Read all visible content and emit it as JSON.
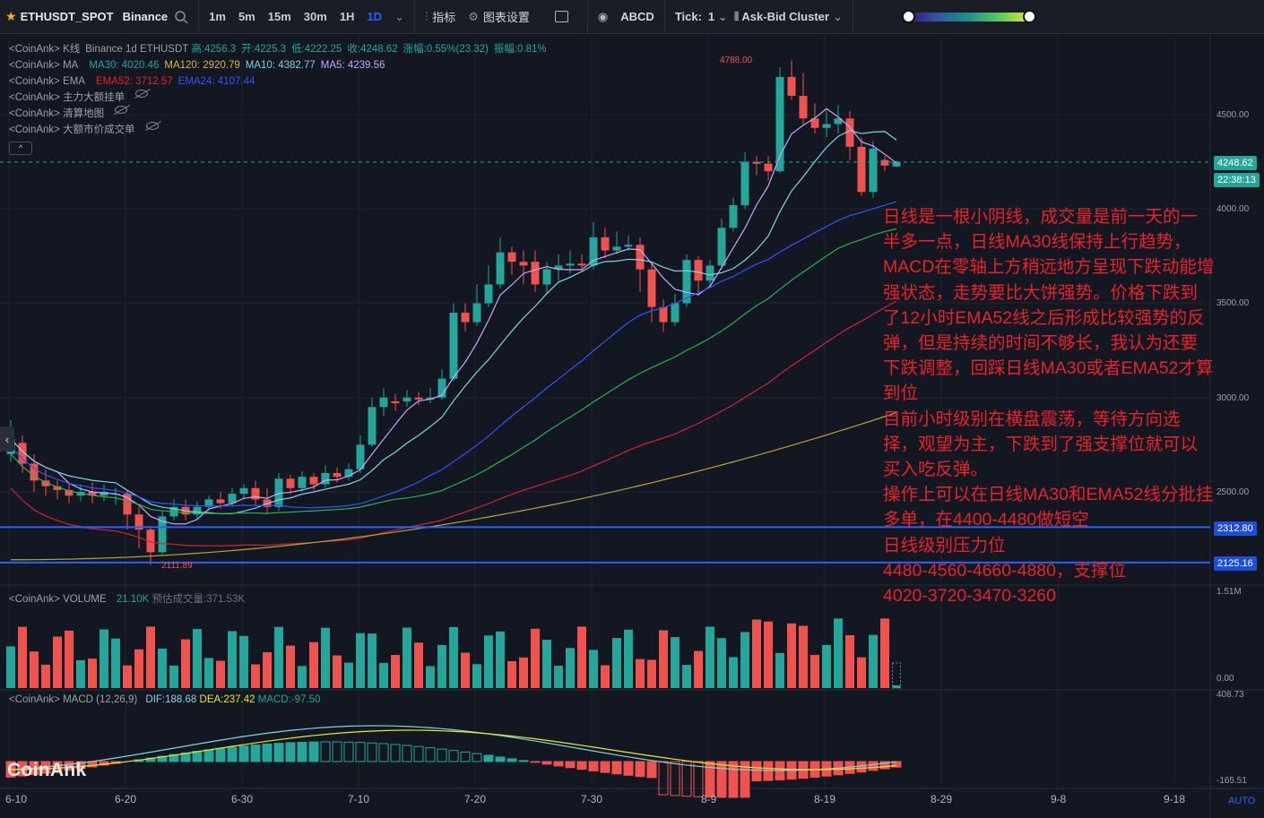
{
  "toolbar": {
    "symbol": "ETHUSDT_SPOT",
    "exchange": "Binance",
    "intervals": [
      "1m",
      "5m",
      "15m",
      "30m",
      "1H",
      "1D"
    ],
    "active_interval": "1D",
    "indicators_label": "指标",
    "settings_label": "图表设置",
    "abcd_label": "ABCD",
    "tick_label": "Tick:",
    "tick_value": "1",
    "cluster_label": "Ask-Bid Cluster",
    "gradient_low": 0,
    "gradient_high": 1
  },
  "legend": {
    "k_prefix": "<CoinAnk> K线",
    "k_detail": "Binance 1d ETHUSDT",
    "high": "高:4256.3",
    "open": "开:4225.3",
    "low": "低:4222.25",
    "close": "收:4248.62",
    "change": "涨幅:0.55%(23.32)",
    "amp": "振幅:0.81%",
    "ma_prefix": "<CoinAnk> MA",
    "ma30": "MA30: 4020.46",
    "ma120": "MA120: 2920.79",
    "ma10": "MA10: 4382.77",
    "ma5": "MA5: 4239.56",
    "ema_prefix": "<CoinAnk> EMA",
    "ema52": "EMA52: 3712.57",
    "ema24": "EMA24: 4107.44",
    "main_orders": "<CoinAnk> 主力大额挂单",
    "liquidation": "<CoinAnk> 清算地图",
    "big_trades": "<CoinAnk> 大额市价成交单"
  },
  "price_axis": {
    "ticks": [
      "4500.00",
      "4000.00",
      "3500.00",
      "3000.00",
      "2500.00"
    ],
    "current_price": "4248.62",
    "countdown": "22:38:13",
    "level1": "2312.80",
    "level2": "2125.16",
    "high_mark": "4788.00",
    "low_mark": "2111.89"
  },
  "volume": {
    "label": "<CoinAnk> VOLUME",
    "value": "21.10K",
    "forecast": "预估成交量:371.53K",
    "top": "1.51M",
    "zero": "0.00"
  },
  "macd": {
    "label": "<CoinAnk> MACD",
    "params": "(12,26,9)",
    "dif": "DIF:188.68",
    "dea": "DEA:237.42",
    "macd": "MACD:-97.50",
    "top": "408.73",
    "bottom": "-165.51"
  },
  "x_axis": [
    "6-10",
    "6-20",
    "6-30",
    "7-10",
    "7-20",
    "7-30",
    "8-9",
    "8-19",
    "8-29",
    "9-8",
    "9-18"
  ],
  "annotation": "日线是一根小阴线，成交量是前一天的一半多一点，日线MA30线保持上行趋势，MACD在零轴上方稍远地方呈现下跌动能增强状态，走势要比大饼强势。价格下跌到了12小时EMA52线之后形成比较强势的反弹，但是持续的时间不够长，我认为还要下跌调整，回踩日线MA30或者EMA52才算到位\n目前小时级别在横盘震荡，等待方向选择，观望为主，下跌到了强支撑位就可以买入吃反弹。\n操作上可以在日线MA30和EMA52线分批挂多单，在4400-4480做短空\n日线级别压力位\n4480-4560-4660-4880，支撑位\n4020-3720-3470-3260",
  "brand": "CoinAnk",
  "auto_label": "AUTO",
  "colors": {
    "up": "#26a69a",
    "down": "#ef5350",
    "bg": "#131722",
    "ma5": "#c9a6ff",
    "ma10": "#7fd3e6",
    "ma30": "#2e56ff",
    "ema24": "#27b34a",
    "ema52": "#d3242c",
    "ma120": "#b8a13a",
    "level": "#2962ff"
  }
}
